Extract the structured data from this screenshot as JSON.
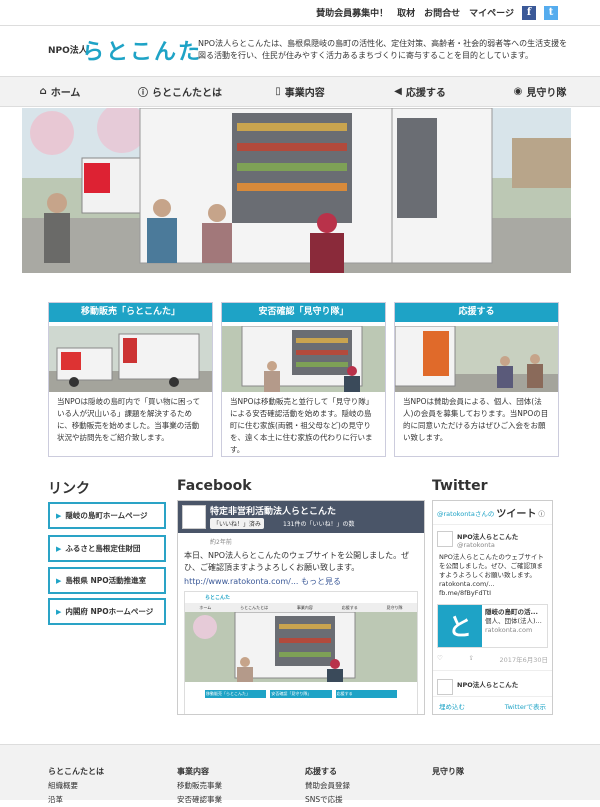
{
  "topbar": {
    "recruit": "賛助会員募集中！",
    "coverage": "取材",
    "contact": "お問合せ",
    "mypage": "マイページ",
    "fb": "f",
    "tw": "t"
  },
  "header": {
    "org": "NPO法人",
    "name": "らとこんた",
    "intro": "NPO法人らとこんたは、島根県隠岐の島町の活性化、定住対策、高齢者・社会的弱者等への生活支援を図る活動を行い、住民が住みやすく活力あるまちづくりに寄与することを目的としています。"
  },
  "nav": [
    {
      "icon": "⌂",
      "label": "ホーム"
    },
    {
      "icon": "ⓘ",
      "label": "らとこんたとは"
    },
    {
      "icon": "▯",
      "label": "事業内容"
    },
    {
      "icon": "◀",
      "label": "応援する"
    },
    {
      "icon": "◉",
      "label": "見守り隊"
    }
  ],
  "cards": [
    {
      "title": "移動販売「らとこんた」",
      "text": "当NPOは隠岐の島町内で「買い物に困っている人が沢山いる」課題を解決するために、移動販売を始めました。当事業の活動状況や訪問先をご紹介致します。"
    },
    {
      "title": "安否確認「見守り隊」",
      "text": "当NPOは移動販売と並行して「見守り隊」による安否確認活動を始めます。隠岐の島町に住む家族(両親・祖父母など)の見守りを、遠く本土に住む家族の代わりに行います。"
    },
    {
      "title": "応援する",
      "text": "当NPOは賛助会員による、個人、団体(法人)の会員を募集しております。当NPOの目的に同意いただける方はぜひご入会をお願い致します。"
    }
  ],
  "links": {
    "heading": "リンク",
    "items": [
      "隠岐の島町ホームページ",
      "ふるさと島根定住財団",
      "島根県 NPO活動推進室",
      "内閣府 NPOホームページ"
    ]
  },
  "facebook": {
    "heading": "Facebook",
    "page": "特定非営利活動法人らとこんた",
    "like": "「いいね！」済み",
    "likes": "131件の「いいね！」の数",
    "date": "約2年前",
    "post": "本日、NPO法人らとこんたのウェブサイトを公開しました。ぜひ、ご確認頂ますようよろしくお願い致します。",
    "url": "http://www.ratokonta.com/... もっと見る",
    "mini_logo": "らとこんた",
    "mini_nav": [
      "ホーム",
      "らとこんたとは",
      "事業内容",
      "応援する",
      "見守り隊"
    ],
    "mini_cards": [
      "移動販売「らとこんた」",
      "安否確認「見守り隊」",
      "応援する"
    ]
  },
  "twitter": {
    "heading": "Twitter",
    "handle_line": "@ratokontaさんの",
    "tweets_label": "ツイート",
    "user": "NPO法人らとこんた",
    "handle": "@ratokonta",
    "text": "NPO法人らとこんたのウェブサイトを公開しました。ぜひ、ご確認頂ますようよろしくお願い致します。ratokonta.com/... fb.me/8fByFdTtI",
    "card_title": "隠岐の島町の活...",
    "card_sub": "個人、団体(法人)...",
    "card_domain": "ratokonta.com",
    "date": "2017年6月30日",
    "user2": "NPO法人らとこんた",
    "embed": "埋め込む",
    "view": "Twitterで表示"
  },
  "footer": [
    {
      "title": "らとこんたとは",
      "items": [
        "組織概要",
        "沿革"
      ]
    },
    {
      "title": "事業内容",
      "items": [
        "移動販売事業",
        "安否確認事業"
      ]
    },
    {
      "title": "応援する",
      "items": [
        "賛助会員登録",
        "SNSで応援"
      ]
    },
    {
      "title": "見守り隊",
      "items": []
    }
  ],
  "colors": {
    "accent": "#1ea3c6",
    "facebook": "#3b5998",
    "twitter": "#55acee"
  }
}
